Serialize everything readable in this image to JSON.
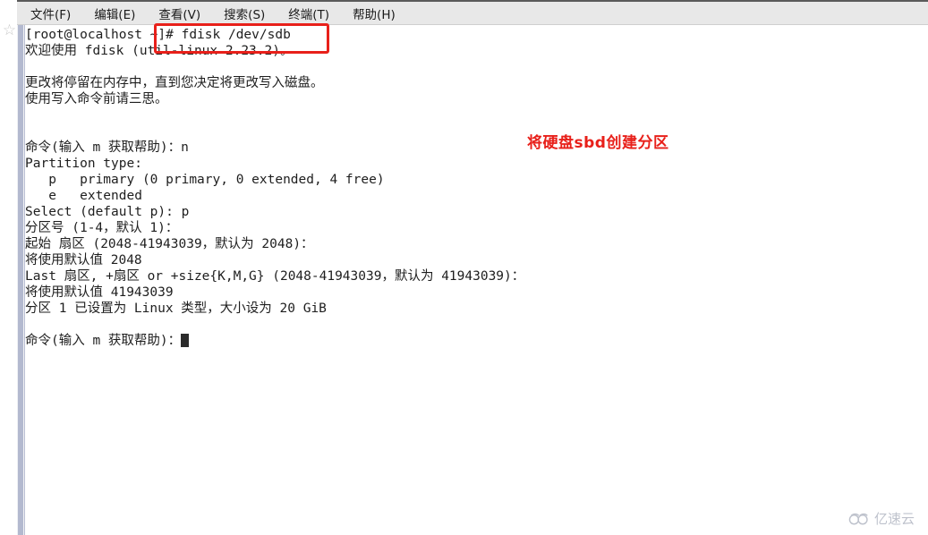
{
  "gutter": {
    "star_icon": "☆"
  },
  "menu": {
    "items": [
      {
        "label": "文件(F)",
        "name": "menu-file"
      },
      {
        "label": "编辑(E)",
        "name": "menu-edit"
      },
      {
        "label": "查看(V)",
        "name": "menu-view"
      },
      {
        "label": "搜索(S)",
        "name": "menu-search"
      },
      {
        "label": "终端(T)",
        "name": "menu-terminal"
      },
      {
        "label": "帮助(H)",
        "name": "menu-help"
      }
    ]
  },
  "terminal": {
    "lines": [
      "[root@localhost ~]# fdisk /dev/sdb",
      "欢迎使用 fdisk (util-linux 2.23.2)。",
      "",
      "更改将停留在内存中，直到您决定将更改写入磁盘。",
      "使用写入命令前请三思。",
      "",
      "",
      "命令(输入 m 获取帮助)：n",
      "Partition type:",
      "   p   primary (0 primary, 0 extended, 4 free)",
      "   e   extended",
      "Select (default p): p",
      "分区号 (1-4，默认 1)：",
      "起始 扇区 (2048-41943039，默认为 2048)：",
      "将使用默认值 2048",
      "Last 扇区, +扇区 or +size{K,M,G} (2048-41943039，默认为 41943039)：",
      "将使用默认值 41943039",
      "分区 1 已设置为 Linux 类型，大小设为 20 GiB",
      "",
      "命令(输入 m 获取帮助)："
    ],
    "prompt_cursor_line_index": 19,
    "background_color": "#ffffff",
    "text_color": "#1e1e1e"
  },
  "annotations": {
    "highlight_box_color": "#e8201a",
    "red_note": "将硬盘sbd创建分区"
  },
  "watermark": {
    "text": "亿速云",
    "color": "#b3b8c4"
  }
}
